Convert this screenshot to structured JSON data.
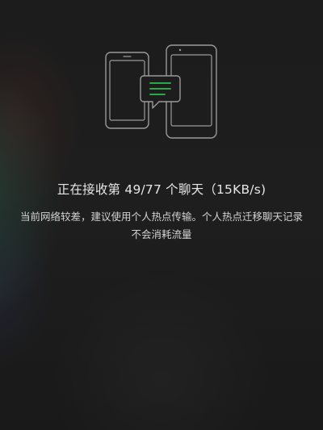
{
  "transfer": {
    "status_text": "正在接收第 49/77 个聊天（15KB/s)",
    "hint_text": "当前网络较差，建议使用个人热点传输。个人热点迁移聊天记录不会消耗流量"
  },
  "illustration": {
    "icons": [
      "phone-icon",
      "tablet-icon",
      "chat-bubble-icon"
    ],
    "line_color": "#9a9a9a",
    "accent_color": "#2bbd4e"
  }
}
